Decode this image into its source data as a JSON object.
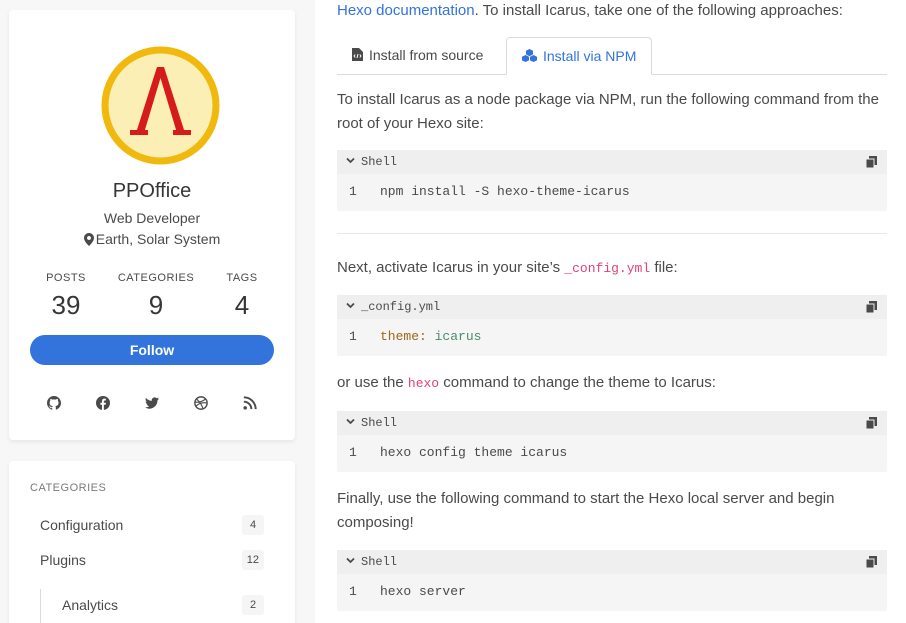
{
  "profile": {
    "name": "PPOffice",
    "title": "Web Developer",
    "location": "Earth, Solar System",
    "stats": [
      {
        "label": "POSTS",
        "value": "39"
      },
      {
        "label": "CATEGORIES",
        "value": "9"
      },
      {
        "label": "TAGS",
        "value": "4"
      }
    ],
    "follow_label": "Follow",
    "social_icons": [
      "github-icon",
      "facebook-icon",
      "twitter-icon",
      "dribbble-icon",
      "rss-icon"
    ]
  },
  "categories": {
    "heading": "CATEGORIES",
    "items": [
      {
        "name": "Configuration",
        "count": "4"
      },
      {
        "name": "Plugins",
        "count": "12"
      },
      {
        "name": "Analytics",
        "count": "2"
      }
    ]
  },
  "content": {
    "intro_link": "Hexo documentation",
    "intro_rest": ". To install Icarus, take one of the following approaches:",
    "tabs": [
      {
        "label": "Install from source",
        "icon": "file-code-icon"
      },
      {
        "label": "Install via NPM",
        "icon": "cubes-icon"
      }
    ],
    "npm_text": "To install Icarus as a node package via NPM, run the following command from the root of your Hexo site:",
    "block1": {
      "lang": "Shell",
      "line": "1",
      "code": "npm install -S hexo-theme-icarus"
    },
    "activate_pre": "Next, activate Icarus in your site’s ",
    "activate_code": "_config.yml",
    "activate_post": " file:",
    "block2": {
      "lang": "_config.yml",
      "line": "1",
      "key": "theme:",
      "value": "icarus"
    },
    "hexo_pre": "or use the ",
    "hexo_code": "hexo",
    "hexo_post": " command to change the theme to Icarus:",
    "block3": {
      "lang": "Shell",
      "line": "1",
      "code": "hexo config theme icarus"
    },
    "final_text": "Finally, use the following command to start the Hexo local server and begin composing!",
    "block4": {
      "lang": "Shell",
      "line": "1",
      "code": "hexo server"
    }
  },
  "colors": {
    "accent": "#3273dc",
    "inline_code": "#e0427a",
    "avatar_ring": "#f1b80d",
    "avatar_symbol": "#d51b1b"
  }
}
